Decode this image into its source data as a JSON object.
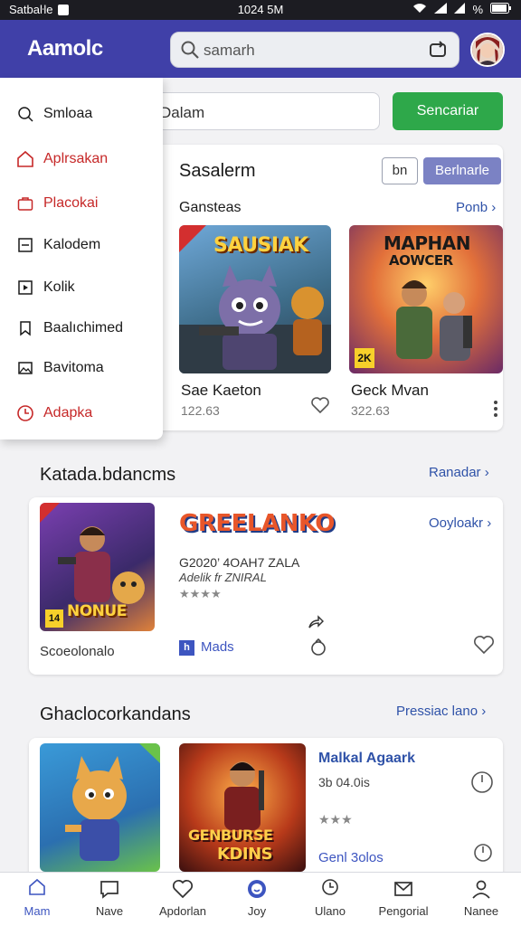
{
  "status_bar": {
    "left_text": "Satbaŀle",
    "time": "1024 5M",
    "right_text": "%"
  },
  "header": {
    "logo": "Aamolc",
    "search_placeholder": "samarh"
  },
  "drawer": {
    "items": [
      {
        "label": "Smloaa",
        "icon": "search-circle-icon",
        "red": false
      },
      {
        "label": "Aplrsakan",
        "icon": "home-icon",
        "red": true
      },
      {
        "label": "Placokai",
        "icon": "briefcase-icon",
        "red": true
      },
      {
        "label": "Kalodem",
        "icon": "square-dash-icon",
        "red": false
      },
      {
        "label": "Kolik",
        "icon": "square-play-icon",
        "red": false
      },
      {
        "label": "Baalıchimed",
        "icon": "bookmark-icon",
        "red": false
      },
      {
        "label": "Bavitoma",
        "icon": "image-icon",
        "red": false
      },
      {
        "label": "Adapka",
        "icon": "clock-icon",
        "red": true
      }
    ]
  },
  "search_row": {
    "input_value": "Dalam",
    "button_label": "Sencariar"
  },
  "section1": {
    "title": "Sasalerm",
    "toggle_plain": "bn",
    "toggle_active": "Berlnarle",
    "subtitle": "Gansteas",
    "link": "Ponb",
    "games": [
      {
        "name": "Sae Kaeton",
        "price": "122.63",
        "art_title": "SAUSIAK",
        "art_sub": "",
        "badge": ""
      },
      {
        "name": "Geck Mvan",
        "price": "322.63",
        "art_title": "MAPHAN",
        "art_sub": "AOWCER",
        "badge": "2K"
      }
    ]
  },
  "section2": {
    "title": "Katada.bdancms",
    "link": "Ranadar",
    "card": {
      "caption": "Scoeolonalo",
      "art_bottom": "NONUE",
      "art_badge": "14",
      "logo_title": "GREELANKO",
      "link": "Ooyloakr",
      "line1": "G2020’ 4OAH7 ZALA",
      "line2": "Adelik fr ZNIRAL",
      "stars": "★★★★",
      "tag": "Mads"
    }
  },
  "section3": {
    "title": "Ghaclocorkandans",
    "link": "Pressiac lano",
    "card": {
      "art2_title": "GENBURSE",
      "art2_sub": "KDINS",
      "game_name": "Malkal Agaark",
      "date": "3b 04.0is",
      "stars": "★★★",
      "tag": "Genl 3olos"
    }
  },
  "bottom_nav": {
    "items": [
      {
        "label": "Mam",
        "icon": "home-icon",
        "active": true
      },
      {
        "label": "Nave",
        "icon": "chat-icon",
        "active": false
      },
      {
        "label": "Apdorlan",
        "icon": "heart-icon",
        "active": false
      },
      {
        "label": "Joy",
        "icon": "smile-icon",
        "active": false
      },
      {
        "label": "Ulano",
        "icon": "clock-icon",
        "active": false
      },
      {
        "label": "Pengorial",
        "icon": "mail-icon",
        "active": false
      },
      {
        "label": "Nanee",
        "icon": "user-icon",
        "active": false
      }
    ]
  },
  "colors": {
    "header": "#4040a8",
    "accent_green": "#2ea84a",
    "link_blue": "#2f52a8",
    "drawer_red": "#c62828"
  }
}
